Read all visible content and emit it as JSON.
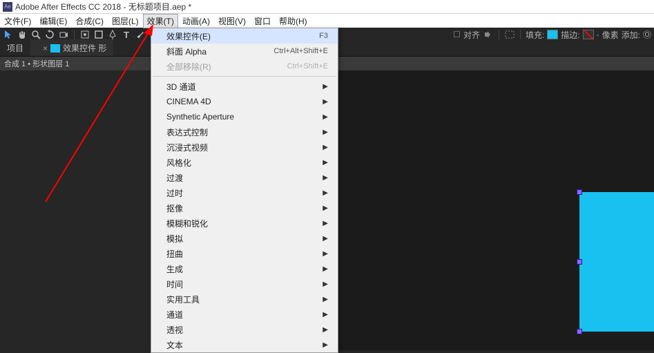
{
  "title_bar": {
    "app_icon_text": "Ae",
    "title": "Adobe After Effects CC 2018 - 无标题项目.aep *"
  },
  "menu_bar": {
    "items": [
      "文件(F)",
      "编辑(E)",
      "合成(C)",
      "图层(L)",
      "效果(T)",
      "动画(A)",
      "视图(V)",
      "窗口",
      "帮助(H)"
    ],
    "active_index": 4
  },
  "toolbar": {
    "selection_icon": "selection-tool",
    "hand_icon": "hand-tool",
    "zoom_icon": "zoom-tool",
    "rotate_icon": "rotate-tool",
    "camera_icon": "camera-tool",
    "panbehind_icon": "pan-behind-tool",
    "shape_icon": "shape-tool",
    "pen_icon": "pen-tool",
    "text_icon": "type-tool",
    "brush_icon": "brush-tool",
    "stamp_icon": "clone-stamp-tool",
    "snap_checkbox": "☐",
    "snap_label": "对齐",
    "fill_label": "填充:",
    "stroke_label": "描边:",
    "stroke_px_dash": "-",
    "stroke_px_unit": "像素",
    "add_label": "添加:",
    "add_icon": "O"
  },
  "panel_tabs": {
    "tab1": "项目",
    "tab2_prefix": "效果控件 形"
  },
  "panel_header": {
    "text": "合成 1 • 形状图层 1"
  },
  "dropdown": {
    "top": [
      {
        "label": "效果控件(E)",
        "shortcut": "F3"
      },
      {
        "label": "斜面 Alpha",
        "shortcut": "Ctrl+Alt+Shift+E"
      },
      {
        "label": "全部移除(R)",
        "shortcut": "Ctrl+Shift+E",
        "disabled": true
      }
    ],
    "sub": [
      "3D 通道",
      "CINEMA 4D",
      "Synthetic Aperture",
      "表达式控制",
      "沉浸式视频",
      "风格化",
      "过渡",
      "过时",
      "抠像",
      "模糊和锐化",
      "模拟",
      "扭曲",
      "生成",
      "时间",
      "实用工具",
      "通道",
      "透视",
      "文本"
    ]
  }
}
